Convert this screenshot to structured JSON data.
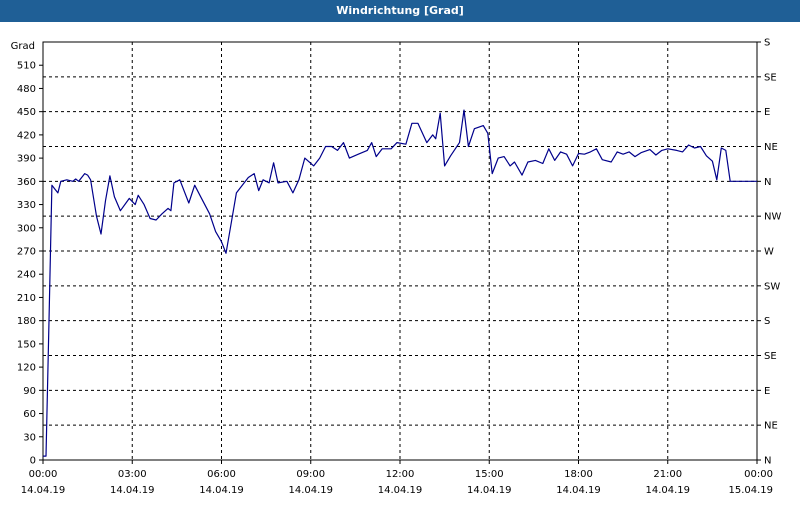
{
  "window": {
    "title": "Windrichtung [Grad]"
  },
  "chart_data": {
    "type": "line",
    "title": "Windrichtung [Grad]",
    "ylabel": "Grad",
    "ylim": [
      0,
      540
    ],
    "yticks": [
      0,
      30,
      60,
      90,
      120,
      150,
      180,
      210,
      240,
      270,
      300,
      330,
      360,
      390,
      420,
      450,
      480,
      510
    ],
    "right_axis_labels": [
      "N",
      "NE",
      "E",
      "SE",
      "S",
      "SW",
      "W",
      "NW",
      "N",
      "NE",
      "E",
      "SE",
      "S"
    ],
    "right_axis_values": [
      0,
      45,
      90,
      135,
      180,
      225,
      270,
      315,
      360,
      405,
      450,
      495,
      540
    ],
    "xlim": [
      0,
      24
    ],
    "x_ticks": [
      {
        "h": 0,
        "time": "00:00",
        "date": "14.04.19"
      },
      {
        "h": 3,
        "time": "03:00",
        "date": "14.04.19"
      },
      {
        "h": 6,
        "time": "06:00",
        "date": "14.04.19"
      },
      {
        "h": 9,
        "time": "09:00",
        "date": "14.04.19"
      },
      {
        "h": 12,
        "time": "12:00",
        "date": "14.04.19"
      },
      {
        "h": 15,
        "time": "15:00",
        "date": "14.04.19"
      },
      {
        "h": 18,
        "time": "18:00",
        "date": "14.04.19"
      },
      {
        "h": 21,
        "time": "21:00",
        "date": "14.04.19"
      },
      {
        "h": 24,
        "time": "00:00",
        "date": "15.04.19"
      }
    ],
    "grid": true,
    "series": [
      {
        "color": "#00008b",
        "points": [
          [
            0.0,
            5
          ],
          [
            0.1,
            5
          ],
          [
            0.2,
            180
          ],
          [
            0.3,
            355
          ],
          [
            0.4,
            350
          ],
          [
            0.5,
            345
          ],
          [
            0.6,
            360
          ],
          [
            0.8,
            362
          ],
          [
            1.0,
            360
          ],
          [
            1.1,
            363
          ],
          [
            1.2,
            360
          ],
          [
            1.4,
            370
          ],
          [
            1.5,
            368
          ],
          [
            1.6,
            362
          ],
          [
            1.8,
            315
          ],
          [
            1.95,
            292
          ],
          [
            2.1,
            335
          ],
          [
            2.25,
            367
          ],
          [
            2.4,
            340
          ],
          [
            2.6,
            322
          ],
          [
            2.9,
            338
          ],
          [
            3.1,
            330
          ],
          [
            3.2,
            342
          ],
          [
            3.4,
            330
          ],
          [
            3.6,
            312
          ],
          [
            3.8,
            310
          ],
          [
            4.0,
            318
          ],
          [
            4.2,
            325
          ],
          [
            4.3,
            322
          ],
          [
            4.4,
            358
          ],
          [
            4.6,
            362
          ],
          [
            4.9,
            332
          ],
          [
            5.1,
            355
          ],
          [
            5.3,
            340
          ],
          [
            5.6,
            318
          ],
          [
            5.8,
            295
          ],
          [
            6.0,
            282
          ],
          [
            6.15,
            267
          ],
          [
            6.3,
            300
          ],
          [
            6.5,
            345
          ],
          [
            6.7,
            355
          ],
          [
            6.9,
            365
          ],
          [
            7.1,
            370
          ],
          [
            7.25,
            348
          ],
          [
            7.4,
            362
          ],
          [
            7.6,
            358
          ],
          [
            7.75,
            384
          ],
          [
            7.9,
            358
          ],
          [
            8.2,
            360
          ],
          [
            8.4,
            345
          ],
          [
            8.6,
            362
          ],
          [
            8.8,
            390
          ],
          [
            9.1,
            380
          ],
          [
            9.3,
            390
          ],
          [
            9.5,
            405
          ],
          [
            9.7,
            405
          ],
          [
            9.9,
            400
          ],
          [
            10.1,
            410
          ],
          [
            10.3,
            390
          ],
          [
            10.6,
            395
          ],
          [
            10.9,
            400
          ],
          [
            11.05,
            410
          ],
          [
            11.2,
            392
          ],
          [
            11.4,
            402
          ],
          [
            11.7,
            402
          ],
          [
            11.9,
            410
          ],
          [
            12.2,
            408
          ],
          [
            12.4,
            435
          ],
          [
            12.6,
            435
          ],
          [
            12.9,
            410
          ],
          [
            13.1,
            420
          ],
          [
            13.2,
            415
          ],
          [
            13.35,
            448
          ],
          [
            13.5,
            380
          ],
          [
            13.7,
            393
          ],
          [
            14.0,
            410
          ],
          [
            14.15,
            452
          ],
          [
            14.3,
            405
          ],
          [
            14.5,
            428
          ],
          [
            14.8,
            432
          ],
          [
            14.95,
            422
          ],
          [
            15.1,
            370
          ],
          [
            15.3,
            390
          ],
          [
            15.5,
            392
          ],
          [
            15.7,
            380
          ],
          [
            15.85,
            385
          ],
          [
            16.1,
            368
          ],
          [
            16.3,
            385
          ],
          [
            16.55,
            387
          ],
          [
            16.8,
            383
          ],
          [
            17.0,
            402
          ],
          [
            17.2,
            387
          ],
          [
            17.4,
            398
          ],
          [
            17.6,
            395
          ],
          [
            17.8,
            380
          ],
          [
            18.0,
            396
          ],
          [
            18.2,
            395
          ],
          [
            18.4,
            398
          ],
          [
            18.6,
            402
          ],
          [
            18.8,
            388
          ],
          [
            19.1,
            385
          ],
          [
            19.3,
            398
          ],
          [
            19.5,
            395
          ],
          [
            19.7,
            398
          ],
          [
            19.9,
            392
          ],
          [
            20.1,
            397
          ],
          [
            20.4,
            401
          ],
          [
            20.6,
            394
          ],
          [
            20.8,
            400
          ],
          [
            21.0,
            402
          ],
          [
            21.3,
            400
          ],
          [
            21.5,
            398
          ],
          [
            21.7,
            407
          ],
          [
            21.9,
            403
          ],
          [
            22.1,
            405
          ],
          [
            22.3,
            393
          ],
          [
            22.5,
            386
          ],
          [
            22.65,
            362
          ],
          [
            22.8,
            403
          ],
          [
            22.95,
            400
          ],
          [
            23.1,
            360
          ],
          [
            23.5,
            360
          ],
          [
            24.0,
            360
          ]
        ]
      }
    ]
  }
}
